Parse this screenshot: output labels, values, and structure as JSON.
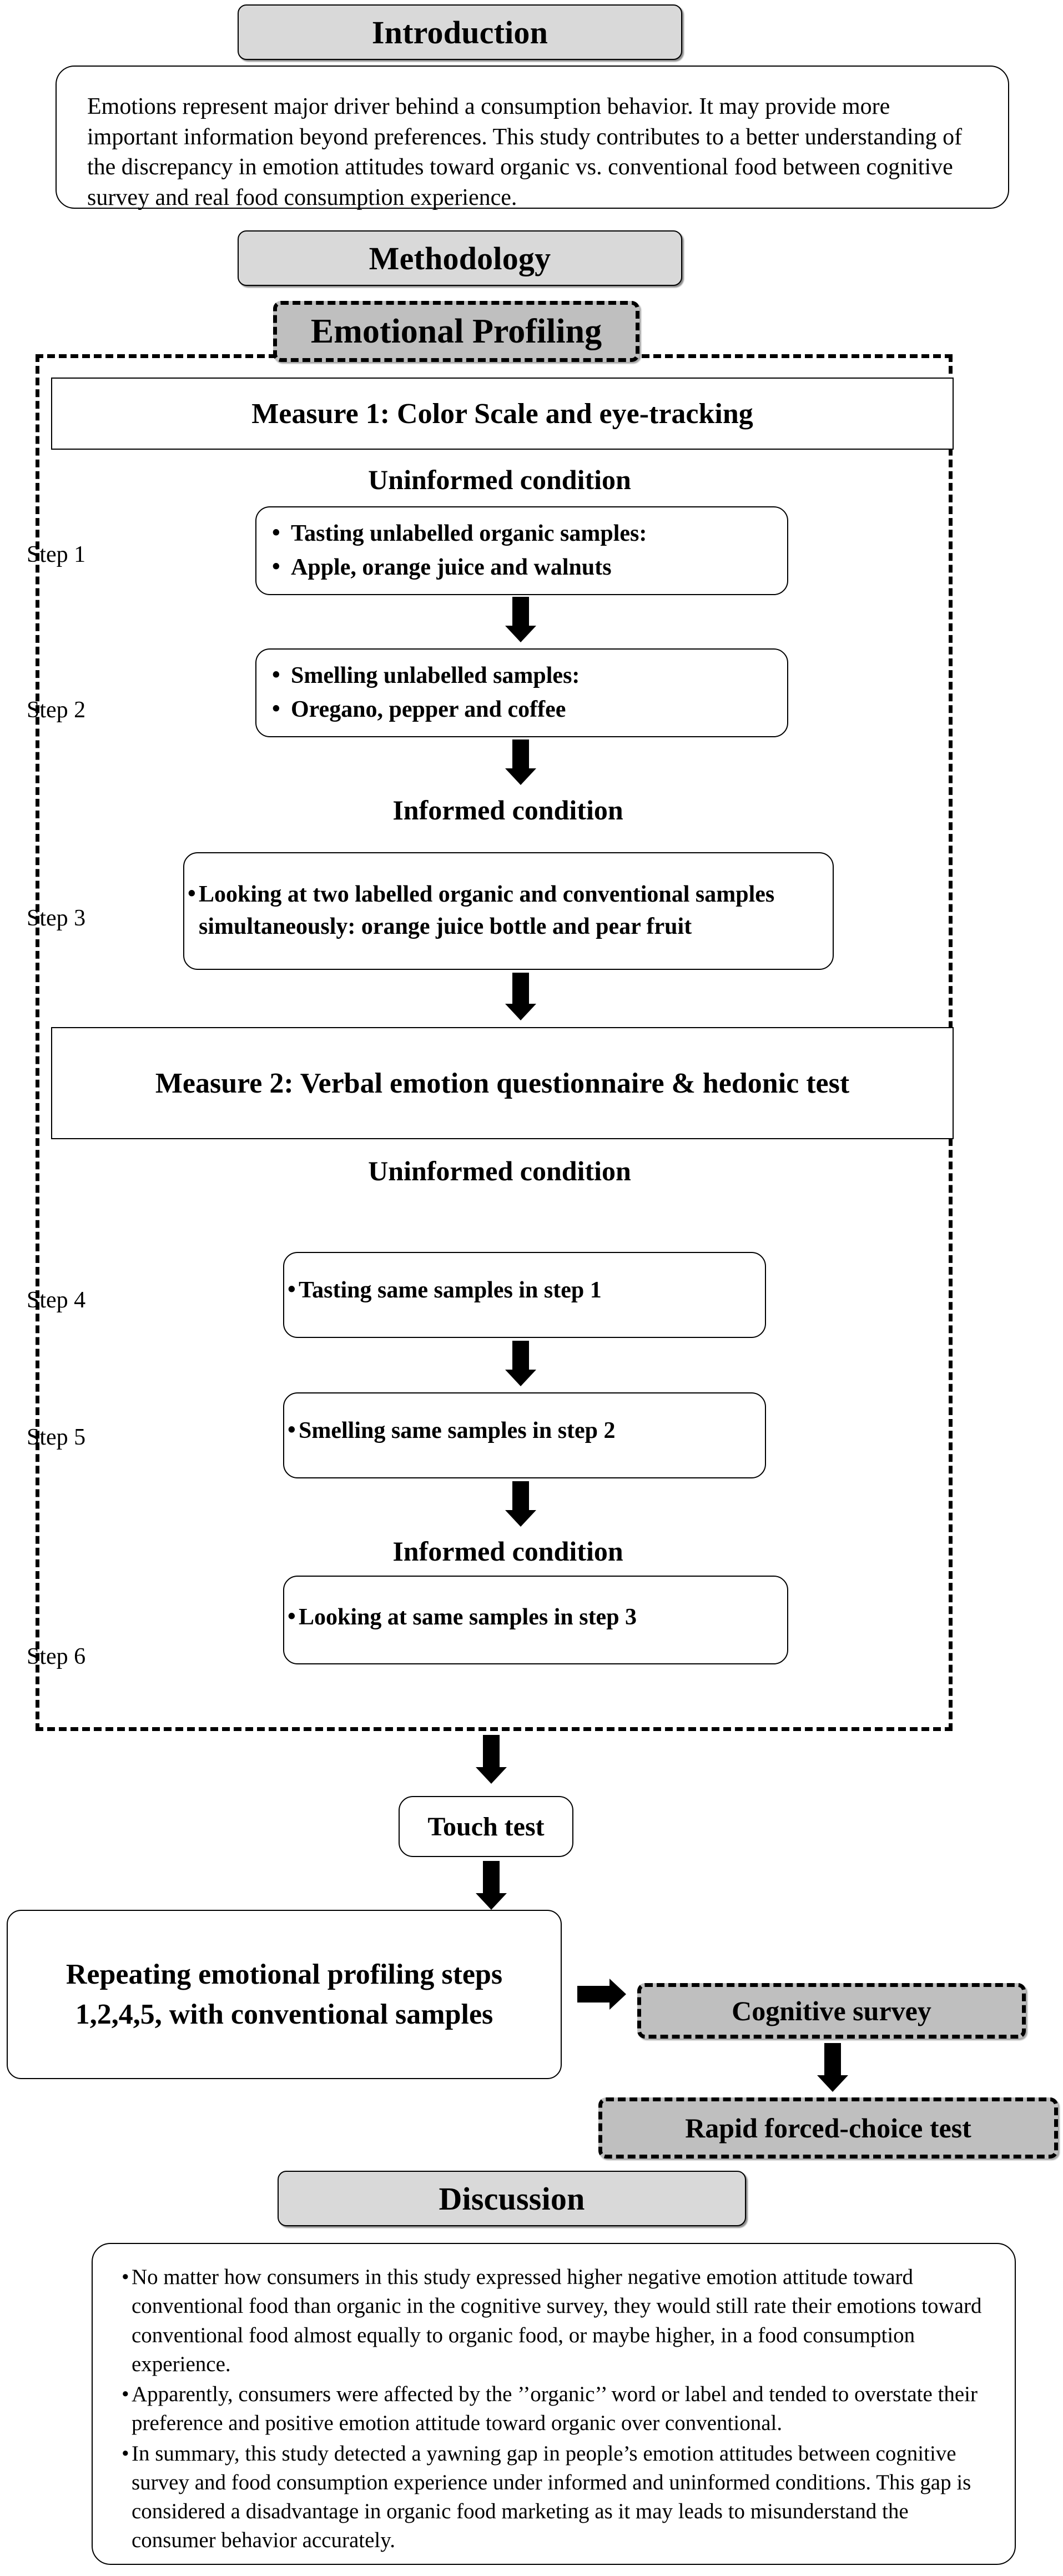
{
  "sections": {
    "introduction": {
      "header": "Introduction",
      "body": "Emotions represent major driver behind a consumption behavior. It may provide more important information beyond preferences. This study contributes to a better understanding of the discrepancy in emotion attitudes toward organic vs. conventional food between cognitive survey and real food consumption experience."
    },
    "methodology": {
      "header": "Methodology",
      "emotional_profiling": "Emotional Profiling"
    },
    "discussion": {
      "header": "Discussion",
      "bullets": [
        "No matter how consumers in this study expressed higher negative emotion attitude toward conventional food than organic in the cognitive survey, they would still rate their emotions toward conventional food almost equally to organic food, or maybe higher, in a food consumption experience.",
        "Apparently, consumers were affected by the ’’organic’’ word or label and tended to overstate their preference and positive emotion attitude toward organic over conventional.",
        "In summary, this study detected a yawning gap in people’s emotion attitudes between cognitive survey and food consumption experience under informed and uninformed conditions. This gap is considered a disadvantage in organic food marketing as it may leads to misunderstand the consumer behavior accurately."
      ]
    }
  },
  "measures": {
    "measure1": "Measure 1: Color Scale and eye-tracking",
    "measure2": "Measure 2: Verbal emotion questionnaire & hedonic test"
  },
  "conditions": {
    "uninformed": "Uninformed condition",
    "informed": "Informed condition"
  },
  "steps": [
    {
      "label": "Step 1",
      "bullets": [
        "Tasting unlabelled organic samples:",
        "Apple, orange juice and walnuts"
      ]
    },
    {
      "label": "Step 2",
      "bullets": [
        "Smelling unlabelled samples:",
        "Oregano, pepper and coffee"
      ]
    },
    {
      "label": "Step 3",
      "bullets": [
        "Looking at two labelled organic and conventional samples simultaneously: orange juice bottle and pear fruit"
      ]
    },
    {
      "label": "Step 4",
      "bullets": [
        "Tasting  same samples in step 1"
      ]
    },
    {
      "label": "Step 5",
      "bullets": [
        "Smelling same samples in step 2"
      ]
    },
    {
      "label": "Step 6",
      "bullets": [
        "Looking at same samples in step 3"
      ]
    }
  ],
  "outcomes": {
    "touch_test": "Touch test",
    "repeating": "Repeating emotional profiling steps 1,2,4,5, with conventional samples",
    "cognitive_survey": "Cognitive survey",
    "rapid_test": "Rapid forced-choice test"
  },
  "colors": {
    "header_fill": "#d9d9d9",
    "dashed_fill": "#bfbfbf",
    "stroke": "#000000",
    "background": "#ffffff"
  }
}
